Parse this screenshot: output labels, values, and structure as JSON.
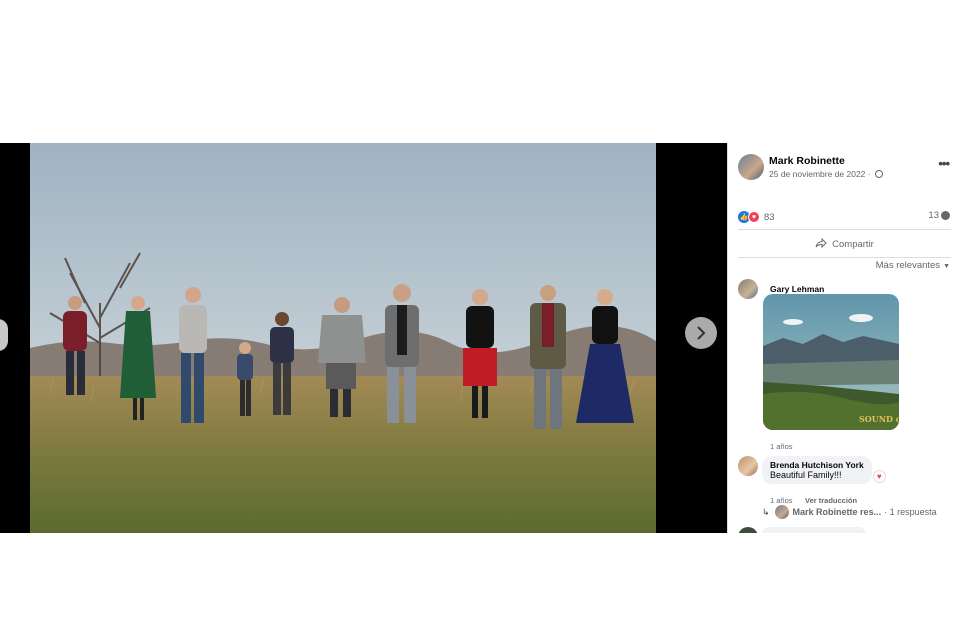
{
  "post": {
    "author": "Mark Robinette",
    "date": "25 de noviembre de 2022 ·",
    "reactions_count": "83",
    "comments_count": "13",
    "share_label": "Compartir",
    "sort_label": "Más relevantes"
  },
  "comments": [
    {
      "author": "Gary Lehman",
      "time": "1 años",
      "gif_caption": "SOUND of MUSIC"
    },
    {
      "author": "Brenda Hutchison York",
      "text": "Beautiful Family!!!",
      "time": "1 años",
      "action": "Ver traducción"
    }
  ],
  "reply_summary": {
    "author": "Mark Robinette res...",
    "count_label": "· 1 respuesta"
  },
  "icons": {
    "next": "chevron-right-icon",
    "more": "more-options-icon",
    "share": "share-arrow-icon",
    "privacy": "globe-icon"
  },
  "colors": {
    "facebook_blue": "#1877f2",
    "love_red": "#f33e58",
    "secondary_text": "#65676b"
  }
}
